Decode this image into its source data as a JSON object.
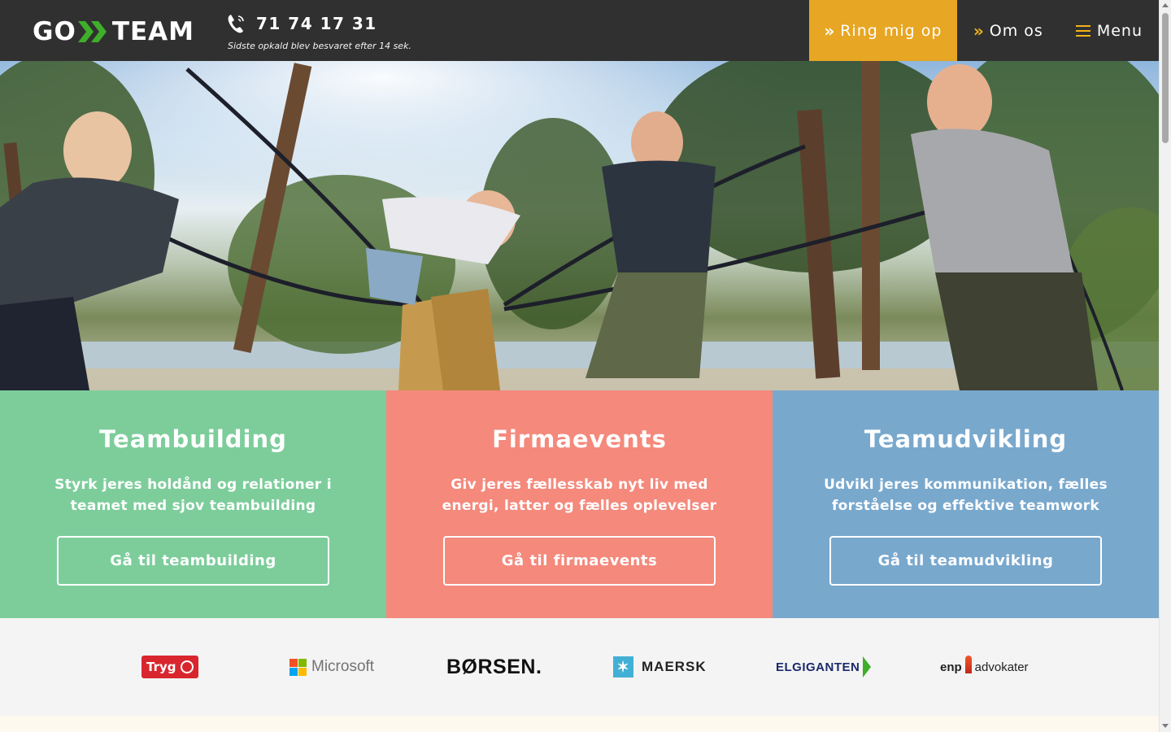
{
  "header": {
    "logo_go": "GO",
    "logo_team": "TEAM",
    "phone_number": "71 74 17 31",
    "phone_note": "Sidste opkald blev besvaret efter 14 sek.",
    "nav": {
      "ring_label": "Ring mig op",
      "about_label": "Om os",
      "menu_label": "Menu"
    }
  },
  "panels": [
    {
      "title": "Teambuilding",
      "text": "Styrk jeres holdånd og relationer i teamet med sjov teambuilding",
      "button": "Gå til teambuilding",
      "color": "#7dcd9b"
    },
    {
      "title": "Firmaevents",
      "text": "Giv jeres fællesskab nyt liv med energi, latter og fælles oplevelser",
      "button": "Gå til firmaevents",
      "color": "#f4897c"
    },
    {
      "title": "Teamudvikling",
      "text": "Udvikl jeres kommunikation, fælles forståelse og effektive teamwork",
      "button": "Gå til teamudvikling",
      "color": "#79a8cd"
    }
  ],
  "client_logos": {
    "tryg": "Tryg",
    "microsoft": "Microsoft",
    "borsen": "BØRSEN.",
    "maersk": "MAERSK",
    "elgiganten": "ELGIGANTEN",
    "enp_mark": "enp",
    "enp_text": "advokater"
  },
  "colors": {
    "header_bg": "#303030",
    "accent": "#e7a623",
    "green": "#7dcd9b",
    "red": "#f4897c",
    "blue": "#79a8cd"
  }
}
